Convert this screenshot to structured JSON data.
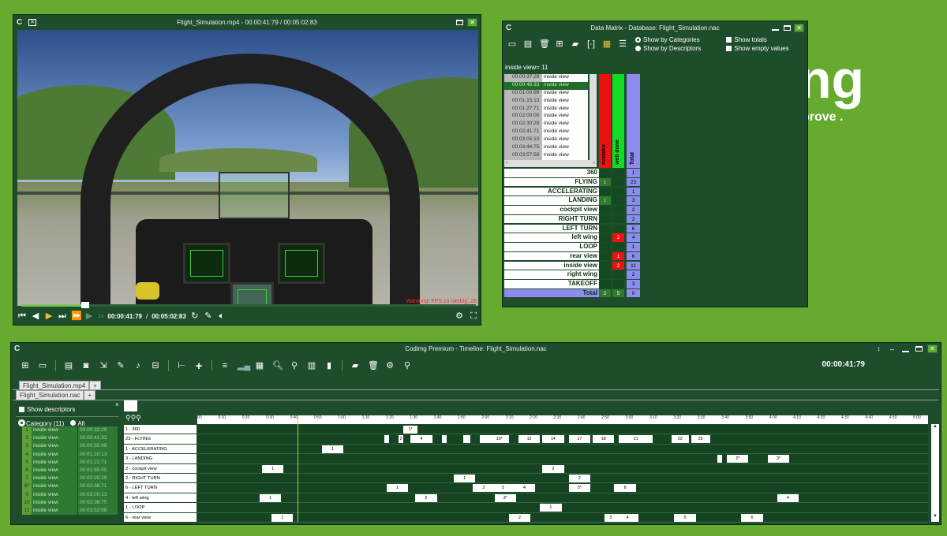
{
  "background": {
    "brand_text": "ng",
    "tagline_text": "prove ."
  },
  "video_window": {
    "title": "Flight_Simulation.mp4 - 00:00:41:79 / 00:05:02:83",
    "current_time": "00:00:41:79",
    "total_time": "00:05:02:83",
    "overlay_warning": "Warnung! FPS zu niedrig: 26",
    "speed_label": "1x",
    "progress_fraction": 0.138
  },
  "data_matrix": {
    "title": "Data Matrix - Database: Flight_Simulation.nac",
    "options": {
      "by_categories": "Show by Categories",
      "by_descriptors": "Show by Descriptors",
      "show_totals": "Show totals",
      "show_empty": "Show empty values"
    },
    "selection_label": "inside view= 11",
    "list": [
      {
        "time": "00:00:37:29",
        "label": "inside view"
      },
      {
        "time": "00:00:46:33",
        "label": "inside view"
      },
      {
        "time": "00:01:00:99",
        "label": "inside view"
      },
      {
        "time": "00:01:15:13",
        "label": "inside view"
      },
      {
        "time": "00:01:27:71",
        "label": "inside view"
      },
      {
        "time": "00:02:00:00",
        "label": "inside view"
      },
      {
        "time": "00:02:30:29",
        "label": "inside view"
      },
      {
        "time": "00:02:41:71",
        "label": "inside view"
      },
      {
        "time": "00:03:05:13",
        "label": "inside view"
      },
      {
        "time": "00:03:44:75",
        "label": "inside view"
      },
      {
        "time": "00:03:57:58",
        "label": "inside view"
      }
    ],
    "columns": [
      "mistake",
      "well done",
      "Total"
    ],
    "rows": [
      {
        "name": "360",
        "mistake": "",
        "well_done": "",
        "total": "1"
      },
      {
        "name": "FLYING",
        "mistake": "1",
        "well_done": "",
        "total": "23"
      },
      {
        "name": "ACCELERATING",
        "mistake": "",
        "well_done": "",
        "total": "1"
      },
      {
        "name": "LANDING",
        "mistake": "1",
        "well_done": "",
        "total": "3"
      },
      {
        "name": "cockpit view",
        "mistake": "",
        "well_done": "",
        "total": "2"
      },
      {
        "name": "RIGHT TURN",
        "mistake": "",
        "well_done": "",
        "total": "2"
      },
      {
        "name": "LEFT TURN",
        "mistake": "",
        "well_done": "",
        "total": "6"
      },
      {
        "name": "left wing",
        "mistake": "",
        "well_done": "2",
        "total": "4"
      },
      {
        "name": "LOOP",
        "mistake": "",
        "well_done": "",
        "total": "1"
      },
      {
        "name": "rear view",
        "mistake": "",
        "well_done": "1",
        "total": "6"
      },
      {
        "name": "inside view",
        "mistake": "",
        "well_done": "2",
        "total": "11"
      },
      {
        "name": "right wing",
        "mistake": "",
        "well_done": "",
        "total": "2"
      },
      {
        "name": "TAKEOFF",
        "mistake": "",
        "well_done": "",
        "total": "3"
      },
      {
        "name": "Total",
        "mistake": "2",
        "well_done": "5",
        "total": "0"
      }
    ],
    "colors": {
      "mistake": "#ee1111",
      "well_done": "#11dd22",
      "total": "#8b8bf0"
    }
  },
  "timeline": {
    "title": "Codimg Premium - Timeline: Flight_Simulation.nac",
    "clock": "00:00:41:79",
    "tab_outer": "Flight_Simulation.mp4",
    "tab_inner": "Flight_Simulation.nac",
    "show_descriptors": "Show descriptors",
    "filter_category": "Category (11)",
    "filter_all": "All",
    "left_list": [
      {
        "n": "1",
        "label": "inside view",
        "time": "00:00:32:29"
      },
      {
        "n": "2",
        "label": "inside view",
        "time": "00:00:41:33"
      },
      {
        "n": "3",
        "label": "inside view",
        "time": "00:00:55:99"
      },
      {
        "n": "4",
        "label": "inside view",
        "time": "00:01:10:13"
      },
      {
        "n": "5",
        "label": "inside view",
        "time": "00:01:22:71"
      },
      {
        "n": "6",
        "label": "inside view",
        "time": "00:01:55:00"
      },
      {
        "n": "7",
        "label": "inside view",
        "time": "00:02:25:29"
      },
      {
        "n": "8*",
        "label": "inside view",
        "time": "00:02:36:71"
      },
      {
        "n": "9",
        "label": "inside view",
        "time": "00:03:00:13"
      },
      {
        "n": "10",
        "label": "inside view",
        "time": "00:03:39:75"
      },
      {
        "n": "11",
        "label": "inside view",
        "time": "00:03:52:58"
      }
    ],
    "ruler": [
      "0:00",
      "0:10",
      "0:20",
      "0:30",
      "0:40",
      "0:50",
      "1:00",
      "1:10",
      "1:20",
      "1:30",
      "1:40",
      "1:50",
      "2:00",
      "2:10",
      "2:20",
      "2:30",
      "2:40",
      "2:50",
      "3:00",
      "3:10",
      "3:20",
      "3:30",
      "3:40",
      "3:50",
      "4:00",
      "4:10",
      "4:20",
      "4:30",
      "4:40",
      "4:50",
      "5:00"
    ],
    "rows": [
      {
        "label": "1 - 360",
        "events": [
          {
            "t": 86,
            "w": 6,
            "text": "1*"
          }
        ]
      },
      {
        "label": "23 - FLYING",
        "events": [
          {
            "t": 78,
            "w": 2,
            "text": ""
          },
          {
            "t": 84,
            "w": 2,
            "text": "2"
          },
          {
            "t": 89,
            "w": 9,
            "text": "4"
          },
          {
            "t": 102,
            "w": 2,
            "text": ""
          },
          {
            "t": 111,
            "w": 3,
            "text": ""
          },
          {
            "t": 118,
            "w": 4,
            "text": ""
          },
          {
            "t": 122,
            "w": 8,
            "text": "10*"
          },
          {
            "t": 134,
            "w": 9,
            "text": "12"
          },
          {
            "t": 144,
            "w": 9,
            "text": "14"
          },
          {
            "t": 155,
            "w": 9,
            "text": "17"
          },
          {
            "t": 165,
            "w": 9,
            "text": "18"
          },
          {
            "t": 176,
            "w": 14,
            "text": "21"
          },
          {
            "t": 198,
            "w": 7,
            "text": "22"
          },
          {
            "t": 206,
            "w": 8,
            "text": "23"
          }
        ]
      },
      {
        "label": "1 - ACCELERATING",
        "events": [
          {
            "t": 52,
            "w": 9,
            "text": "1"
          }
        ]
      },
      {
        "label": "3 - LANDING",
        "events": [
          {
            "t": 217,
            "w": 2,
            "text": ""
          },
          {
            "t": 221,
            "w": 9,
            "text": "2*"
          },
          {
            "t": 238,
            "w": 9,
            "text": "3*"
          }
        ]
      },
      {
        "label": "2 - cockpit view",
        "events": [
          {
            "t": 27,
            "w": 9,
            "text": "1"
          },
          {
            "t": 144,
            "w": 9,
            "text": "2"
          }
        ]
      },
      {
        "label": "2 - RIGHT TURN",
        "events": [
          {
            "t": 107,
            "w": 9,
            "text": "1"
          },
          {
            "t": 155,
            "w": 9,
            "text": "2"
          }
        ]
      },
      {
        "label": "6 - LEFT TURN",
        "events": [
          {
            "t": 79,
            "w": 9,
            "text": "1"
          },
          {
            "t": 115,
            "w": 9,
            "text": "2"
          },
          {
            "t": 123,
            "w": 9,
            "text": "3"
          },
          {
            "t": 132,
            "w": 9,
            "text": "4"
          },
          {
            "t": 155,
            "w": 9,
            "text": "5*"
          },
          {
            "t": 174,
            "w": 9,
            "text": "6"
          }
        ]
      },
      {
        "label": "4 - left wing",
        "events": [
          {
            "t": 26,
            "w": 9,
            "text": "1"
          },
          {
            "t": 91,
            "w": 9,
            "text": "2"
          },
          {
            "t": 124,
            "w": 9,
            "text": "3*"
          },
          {
            "t": 242,
            "w": 9,
            "text": "4"
          }
        ]
      },
      {
        "label": "1 - LOOP",
        "events": [
          {
            "t": 143,
            "w": 9,
            "text": "1"
          }
        ]
      },
      {
        "label": "6 - rear view",
        "events": [
          {
            "t": 31,
            "w": 9,
            "text": "1"
          },
          {
            "t": 130,
            "w": 9,
            "text": "2"
          },
          {
            "t": 170,
            "w": 5,
            "text": "3"
          },
          {
            "t": 175,
            "w": 9,
            "text": "4"
          },
          {
            "t": 199,
            "w": 9,
            "text": "5"
          },
          {
            "t": 227,
            "w": 9,
            "text": "6"
          }
        ]
      }
    ],
    "playhead": 41.79
  }
}
